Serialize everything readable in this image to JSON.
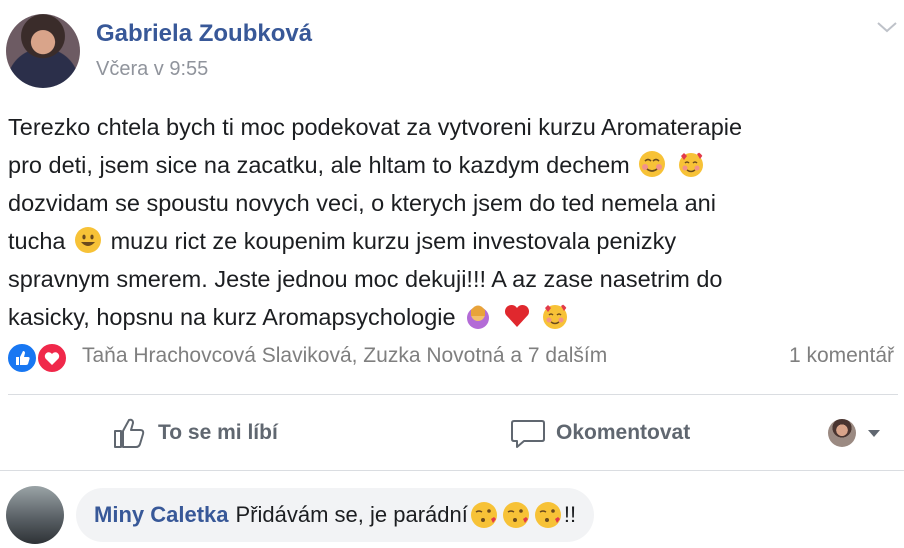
{
  "post": {
    "author": "Gabriela Zoubková",
    "timestamp": "Včera v 9:55",
    "lines": [
      "Terezko chtela bych ti moc podekovat za vytvoreni kurzu Aromaterapie",
      "pro deti, jsem sice na zacatku, ale hltam to kazdym dechem",
      "dozvidam se spoustu novych veci, o kterych jsem do ted nemela ani",
      "tucha",
      "muzu rict ze koupenim kurzu jsem investovala penizky",
      "spravnym smerem. Jeste jednou moc dekuji!!! A az zase nasetrim do",
      "kasicky, hopsnu na kurz Aromapsychologie"
    ],
    "reactions": {
      "names": "Taňa Hrachovcová Slaviková, Zuzka Novotná a 7 dalším",
      "comment_count": "1 komentář",
      "icons": [
        "like-reaction-icon",
        "love-reaction-icon"
      ]
    },
    "actions": {
      "like": "To se mi líbí",
      "comment": "Okomentovat"
    }
  },
  "comment": {
    "author": "Miny Caletka",
    "text": "Přidávám se, je parádní",
    "suffix": "!!"
  },
  "colors": {
    "link": "#385898",
    "meta": "#90949c",
    "like_blue": "#1877f2",
    "love_red": "#f0284a",
    "bubble": "#f2f3f5"
  }
}
